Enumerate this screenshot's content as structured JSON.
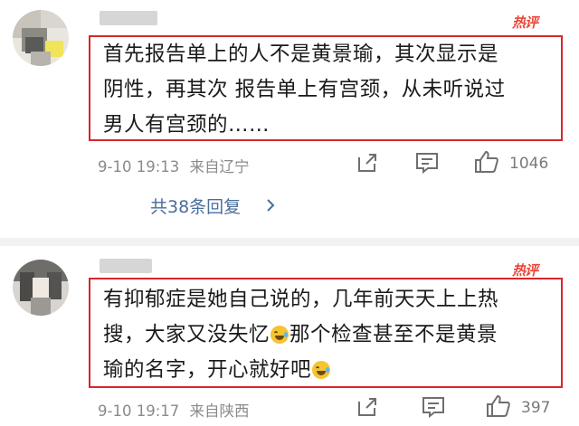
{
  "comments": [
    {
      "hot_label": "热评",
      "text_lines": [
        "首先报告单上的人不是黄景瑜，其次显示是",
        "阴性，再其次 报告单上有宫颈，从未听说过",
        "男人有宫颈的……"
      ],
      "time": "9-10 19:13",
      "location": "来自辽宁",
      "likes": "1046",
      "replies": "共38条回复"
    },
    {
      "hot_label": "热评",
      "text_lines": [
        "有抑郁症是她自己说的，几年前天天上上热",
        "搜，大家又没失忆",
        "那个检查甚至不是黄景",
        "瑜的名字，开心就好吧"
      ],
      "time": "9-10 19:17",
      "location": "来自陕西",
      "likes": "397"
    }
  ],
  "icons": {
    "share": "share-icon",
    "comment": "comment-icon",
    "like": "thumbs-up-icon",
    "emoji": "laugh-cry-emoji-icon",
    "replies_arrow": "chevron-right-icon"
  },
  "colors": {
    "highlight_border": "#d8262b",
    "hot_label": "#e8483b",
    "reply_link": "#4a6d9a"
  }
}
